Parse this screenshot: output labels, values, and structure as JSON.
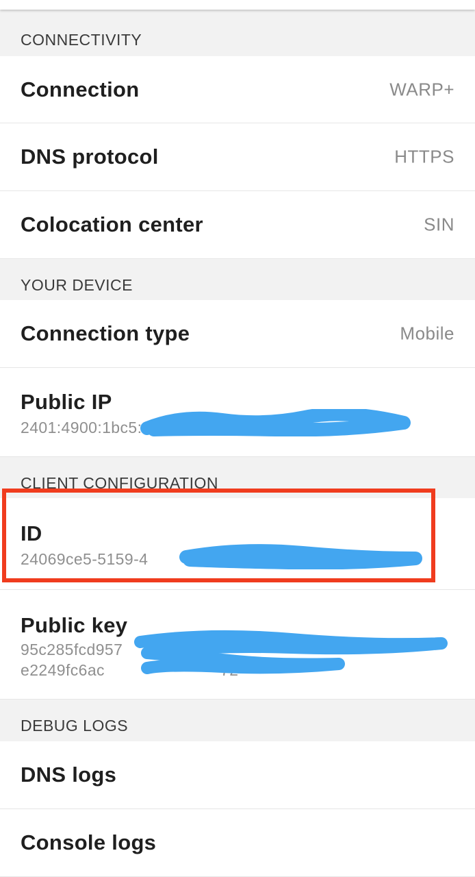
{
  "sections": {
    "connectivity": {
      "header": "CONNECTIVITY",
      "rows": [
        {
          "label": "Connection",
          "value": "WARP+"
        },
        {
          "label": "DNS protocol",
          "value": "HTTPS"
        },
        {
          "label": "Colocation center",
          "value": "SIN"
        }
      ]
    },
    "your_device": {
      "header": "YOUR DEVICE",
      "connection_type": {
        "label": "Connection type",
        "value": "Mobile"
      },
      "public_ip": {
        "label": "Public IP",
        "value": "2401:4900:1bc5:"
      }
    },
    "client_configuration": {
      "header": "CLIENT CONFIGURATION",
      "id": {
        "label": "ID",
        "value": "24069ce5-5159-4"
      },
      "public_key": {
        "label": "Public key",
        "value_line1": "95c285fcd957",
        "value_line2": "e2249fc6ac",
        "value_line2_tail": "72"
      }
    },
    "debug_logs": {
      "header": "DEBUG LOGS",
      "rows": [
        {
          "label": "DNS logs"
        },
        {
          "label": "Console logs"
        }
      ]
    }
  },
  "colors": {
    "highlight": "#f03c1e",
    "redaction": "#43a6f0",
    "header_bg": "#f2f2f2",
    "row_bg": "#ffffff"
  }
}
